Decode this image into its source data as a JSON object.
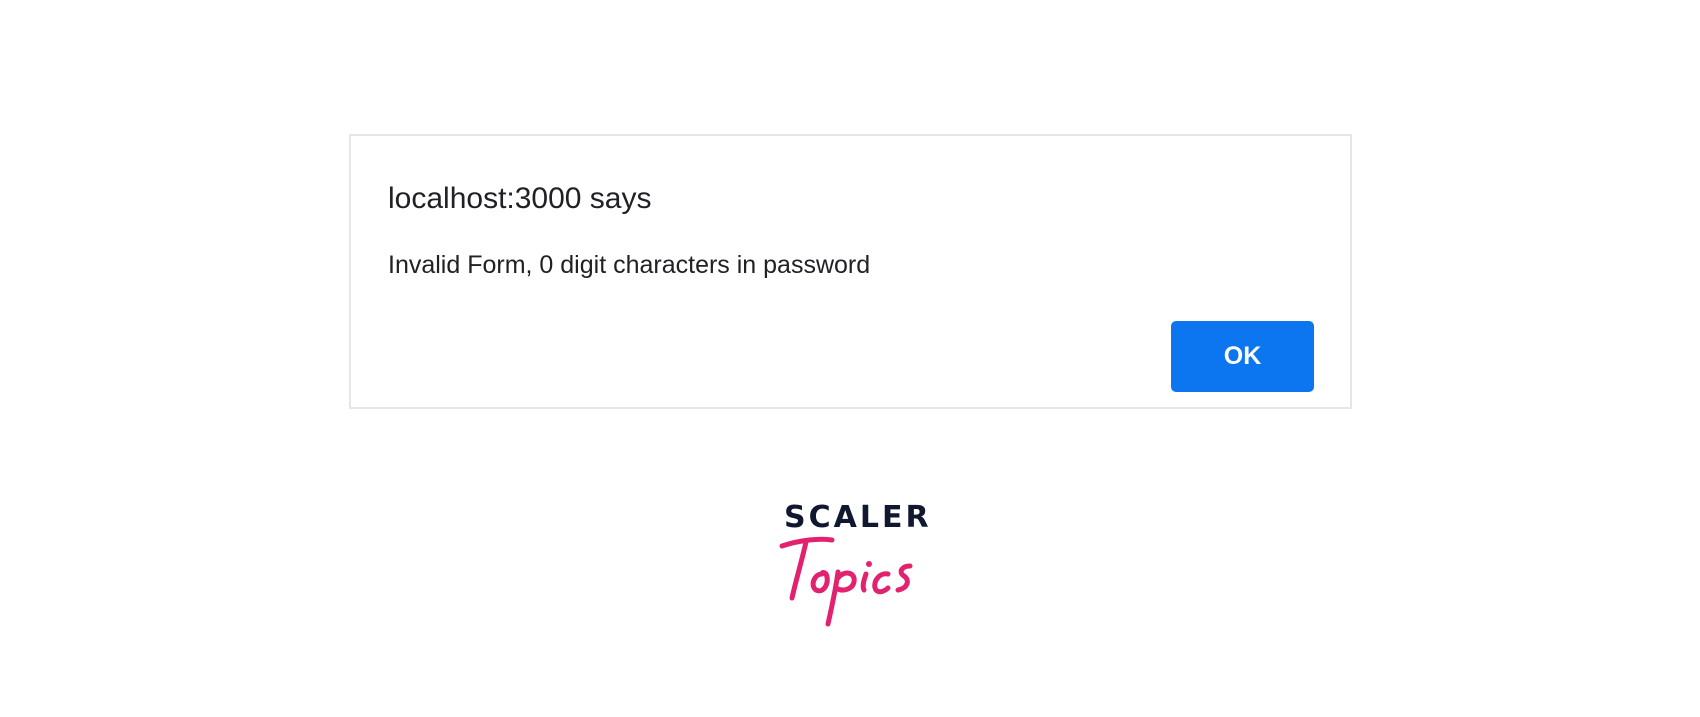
{
  "dialog": {
    "title": "localhost:3000 says",
    "message": "Invalid Form, 0 digit characters in password",
    "ok_label": "OK"
  },
  "logo": {
    "wordmark": "SCALER",
    "script": "Topics"
  },
  "colors": {
    "button_bg": "#0b76f0",
    "button_text": "#ffffff",
    "dialog_border": "#e6e6e6",
    "text": "#202124",
    "logo_dark": "#101830",
    "logo_pink": "#e3226f"
  }
}
